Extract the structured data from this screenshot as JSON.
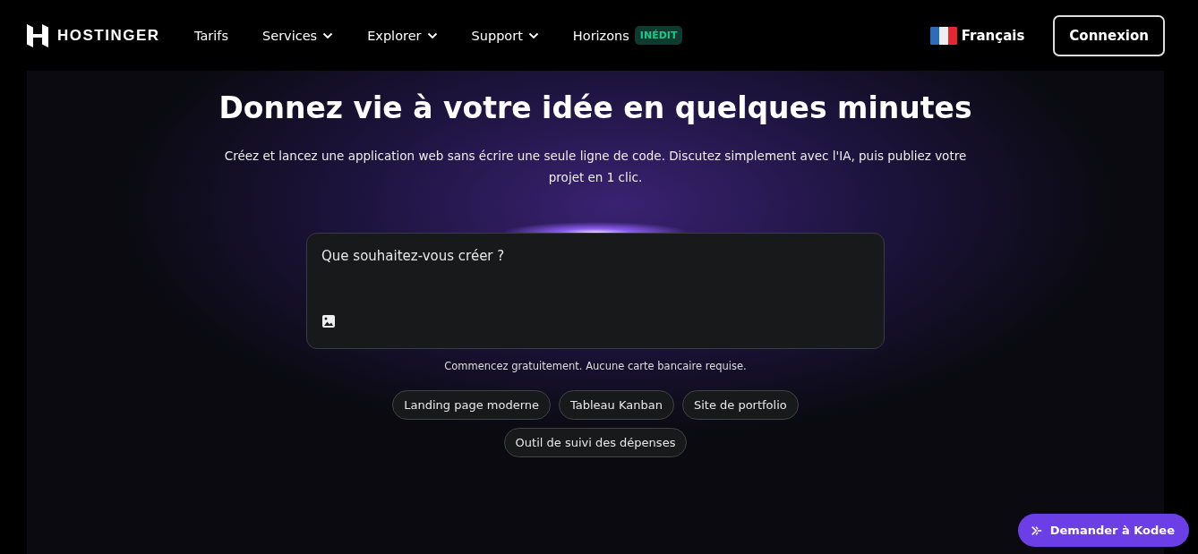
{
  "header": {
    "logo": "HOSTINGER",
    "nav": [
      {
        "label": "Tarifs",
        "dropdown": false
      },
      {
        "label": "Services",
        "dropdown": true
      },
      {
        "label": "Explorer",
        "dropdown": true
      },
      {
        "label": "Support",
        "dropdown": true
      },
      {
        "label": "Horizons",
        "dropdown": false,
        "badge": "INÉDIT"
      }
    ],
    "language": "Français",
    "login": "Connexion"
  },
  "hero": {
    "title": "Donnez vie à votre idée en quelques minutes",
    "subtitle": "Créez et lancez une application web sans écrire une seule ligne de code. Discutez simplement avec l'IA, puis publiez votre projet en 1 clic.",
    "prompt": {
      "placeholder": "Que souhaitez-vous créer ?"
    },
    "note": "Commencez gratuitement. Aucune carte bancaire requise.",
    "suggestions": [
      "Landing page moderne",
      "Tableau Kanban",
      "Site de portfolio",
      "Outil de suivi des dépenses"
    ]
  },
  "chat_button": "Demander à Kodee"
}
